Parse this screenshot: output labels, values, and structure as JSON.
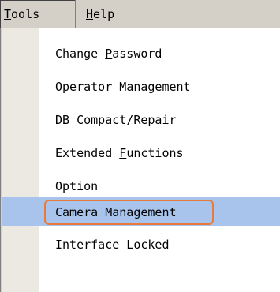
{
  "menubar": {
    "tools": {
      "accel": "T",
      "rest": "ools"
    },
    "help": {
      "accel": "H",
      "rest": "elp"
    }
  },
  "menu": {
    "change_password": {
      "pre": "Change ",
      "accel": "P",
      "post": "assword"
    },
    "operator_management": {
      "pre": "Operator ",
      "accel": "M",
      "post": "anagement"
    },
    "db_compact": {
      "pre": "DB Compact/",
      "accel": "R",
      "post": "epair"
    },
    "extended_functions": {
      "pre": "Extended ",
      "accel": "F",
      "post": "unctions"
    },
    "option": {
      "label": "Option"
    },
    "camera_management": {
      "label": "Camera Management"
    },
    "interface_locked": {
      "label": "Interface Locked"
    }
  },
  "colors": {
    "highlight": "#a8c4ec",
    "callout_border": "#e87a3a",
    "menubar_bg": "#d4d0c8"
  }
}
